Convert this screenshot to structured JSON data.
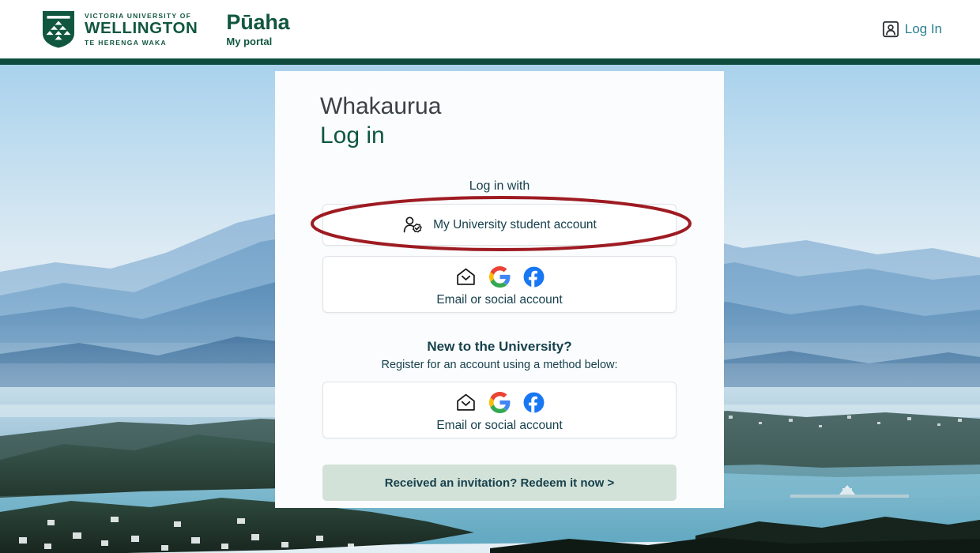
{
  "header": {
    "logo": {
      "icon": "vuw-shield-icon",
      "line1": "VICTORIA UNIVERSITY OF",
      "line2": "WELLINGTON",
      "line3": "TE HERENGA WAKA"
    },
    "portal": {
      "name": "Pūaha",
      "subtitle": "My portal"
    },
    "login_link": {
      "icon": "user-account-icon",
      "label": "Log In"
    },
    "rule_color": "#0d4c3c"
  },
  "card": {
    "title_maori": "Whakaurua",
    "title_english": "Log in",
    "login_with_label": "Log in with",
    "primary_button": {
      "icon": "person-verified-icon",
      "label": "My University student account"
    },
    "social_login_button": {
      "icons": [
        "email-envelope-icon",
        "google-icon",
        "facebook-icon"
      ],
      "label": "Email or social account"
    },
    "new_user_heading": "New to the University?",
    "new_user_sub": "Register for an account using a method below:",
    "social_register_button": {
      "icons": [
        "email-envelope-icon",
        "google-icon",
        "facebook-icon"
      ],
      "label": "Email or social account"
    },
    "invitation_button": {
      "label": "Received an invitation? Redeem it now >",
      "background": "#d3e2d8"
    }
  },
  "annotation": {
    "shape": "ellipse",
    "color": "#9e1b22",
    "target": "My University student account"
  },
  "colors": {
    "brand_green": "#115740",
    "dark_green_rule": "#0d4c3c",
    "teal_text": "#17414d",
    "login_link_teal": "#2b7f92",
    "card_background": "#fbfcfd",
    "google_blue": "#4285F4",
    "google_red": "#EA4335",
    "google_yellow": "#FBBC05",
    "google_green": "#34A853",
    "facebook_blue": "#1877F2"
  },
  "background": {
    "description": "Wellington harbour landscape photograph"
  }
}
